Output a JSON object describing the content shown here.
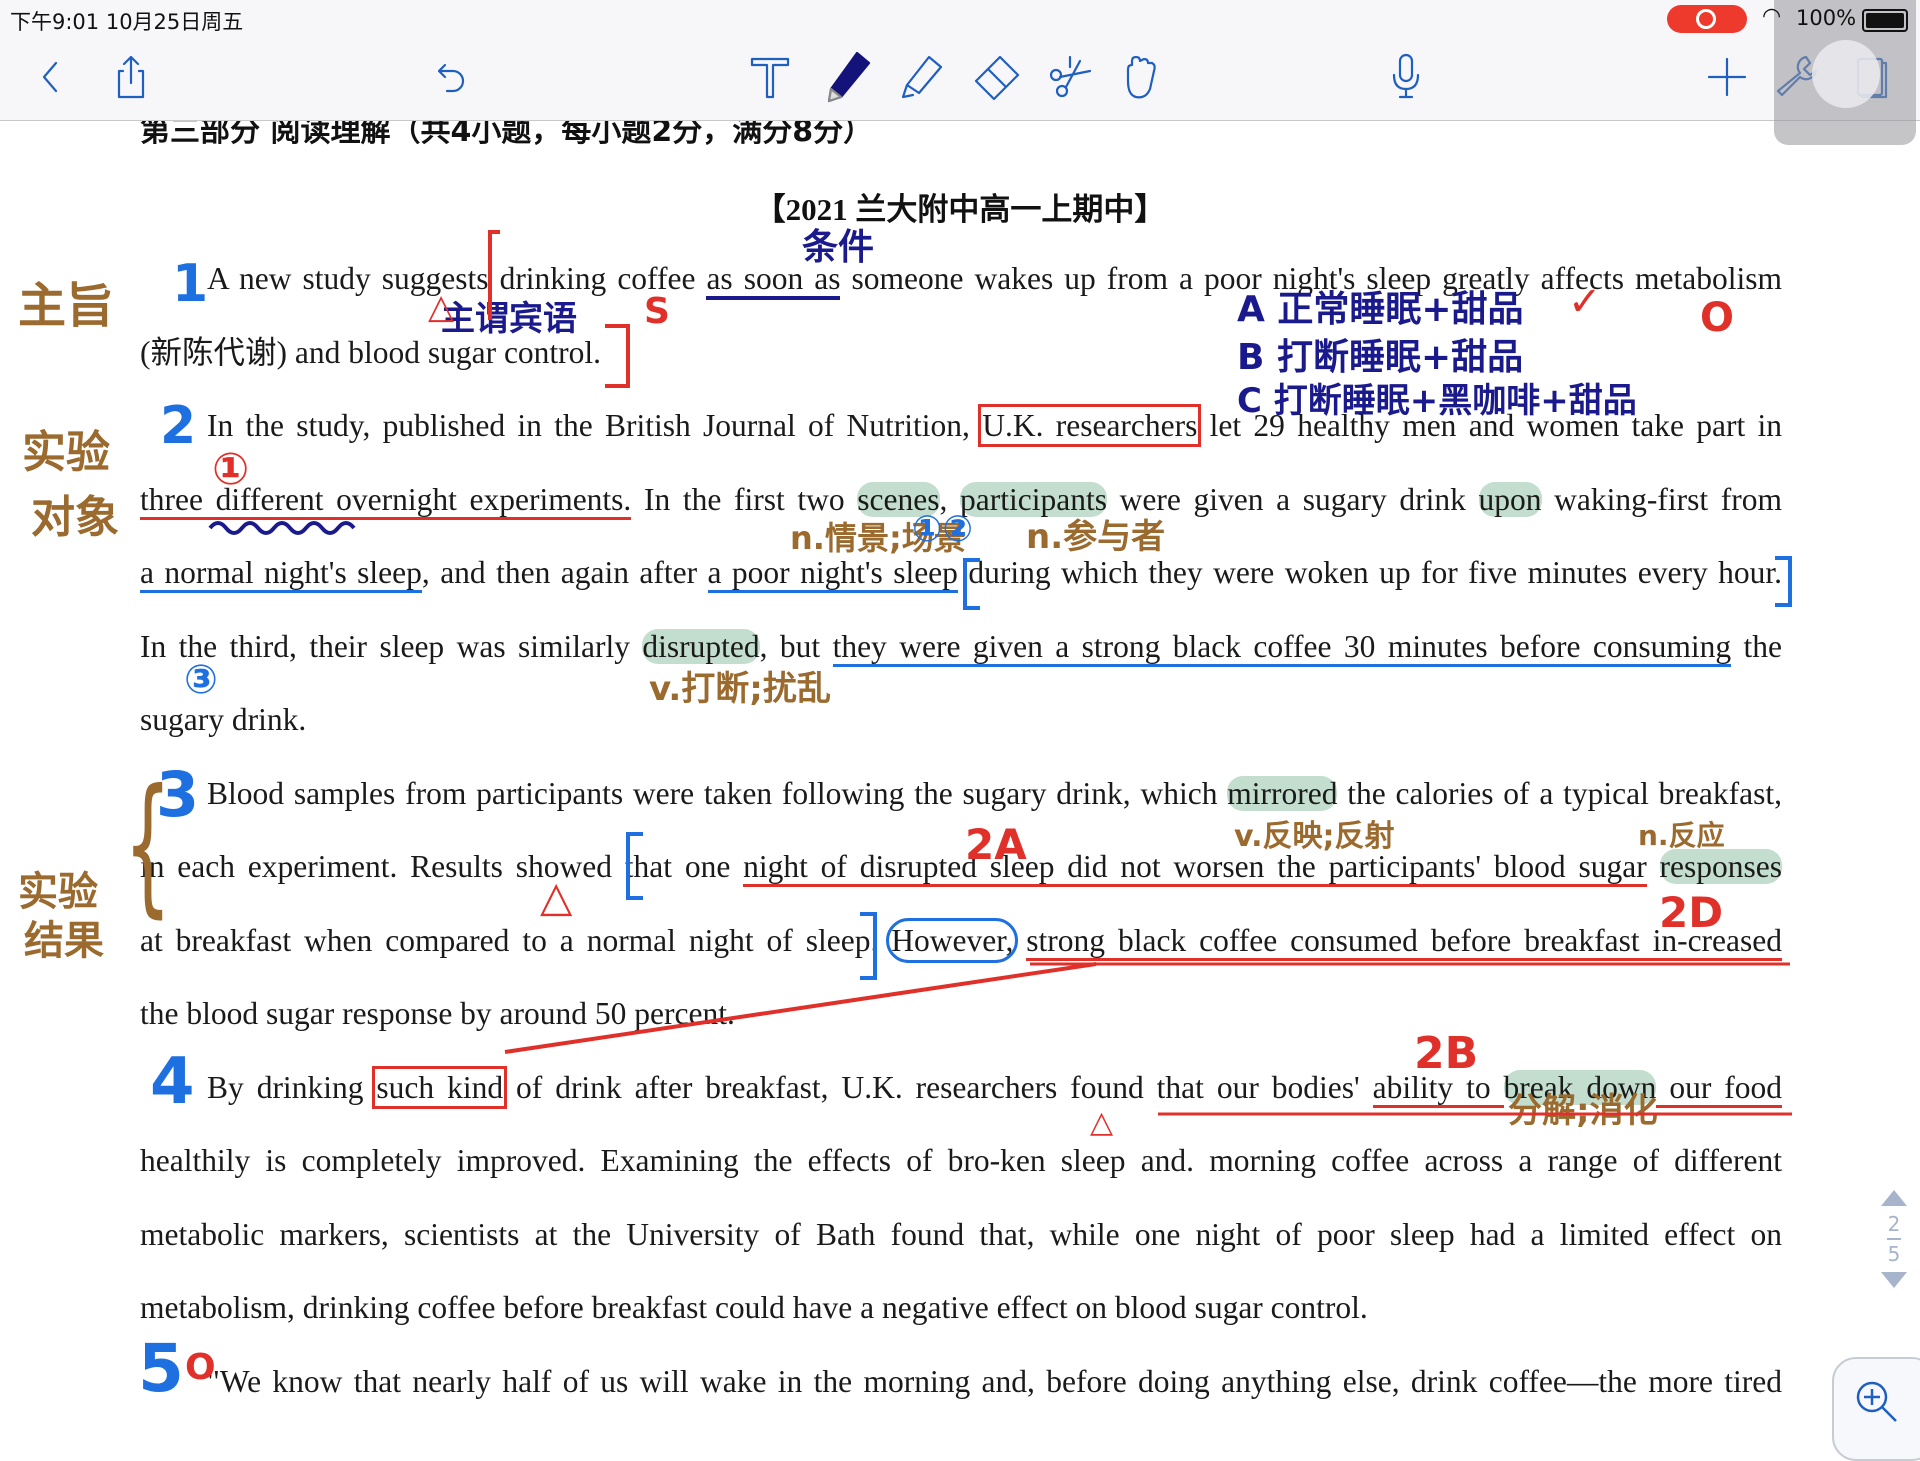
{
  "status": {
    "time": "下午9:01  10月25日周五",
    "battery": "100%",
    "recording": true
  },
  "toolbar": {
    "icons": [
      "back-icon",
      "share-icon",
      "undo-icon",
      "text-tool-icon",
      "pen-tool-icon",
      "highlighter-icon",
      "eraser-icon",
      "lasso-scissors-icon",
      "hand-icon",
      "microphone-icon",
      "add-icon",
      "wrench-icon",
      "pages-icon"
    ],
    "accent": "#1f5fbf",
    "active_tool": "pen-tool-icon"
  },
  "document": {
    "section_title": "第三部分  阅读理解（共4小题，每小题2分，满分8分）",
    "source": "【2021 兰大附中高一上期中】"
  },
  "article": {
    "lines": [
      {
        "segs": [
          {
            "t": "A new study suggests drinking coffee "
          },
          {
            "t": "as soon as",
            "s": "uln"
          },
          {
            "t": " someone wakes up from a poor night's sleep greatly affects metabolism"
          }
        ]
      },
      {
        "segs": [
          {
            "t": "(新陈代谢) and blood sugar control."
          }
        ]
      },
      {
        "segs": [
          {
            "t": "In the study, published in the British Journal of Nutrition, "
          },
          {
            "t": "U.K. researchers",
            "s": "box"
          },
          {
            "t": " let 29 healthy men and women take part in"
          }
        ]
      },
      {
        "segs": [
          {
            "t": "three different overnight experiments.",
            "s": "ulr"
          },
          {
            "t": " In the first two "
          },
          {
            "t": "scenes",
            "s": "hl"
          },
          {
            "t": ", "
          },
          {
            "t": "participants",
            "s": "hl"
          },
          {
            "t": " were given a sugary drink "
          },
          {
            "t": "upon",
            "s": "hl"
          },
          {
            "t": " waking-first from"
          }
        ]
      },
      {
        "segs": [
          {
            "t": "a normal night's sleep",
            "s": "ulb"
          },
          {
            "t": ", and then again after "
          },
          {
            "t": "a poor night's sleep",
            "s": "ulb"
          },
          {
            "t": " during which they were woken up for five minutes every hour."
          }
        ]
      },
      {
        "segs": [
          {
            "t": "In the third, their sleep was similarly "
          },
          {
            "t": "disrupted",
            "s": "hl"
          },
          {
            "t": ", but "
          },
          {
            "t": "they were given a strong black coffee 30 minutes before consuming",
            "s": "ulb"
          },
          {
            "t": " the"
          }
        ]
      },
      {
        "segs": [
          {
            "t": "sugary drink."
          }
        ]
      },
      {
        "segs": [
          {
            "t": "Blood samples from participants were taken following the sugary drink, which "
          },
          {
            "t": "mirrored",
            "s": "hl"
          },
          {
            "t": " the calories of a typical breakfast,"
          }
        ]
      },
      {
        "segs": [
          {
            "t": "in each experiment. Results showed that one "
          },
          {
            "t": "night of disrupted sleep did not worsen the participants' blood sugar",
            "s": "ulr"
          },
          {
            "t": " "
          },
          {
            "t": "responses",
            "s": "hl"
          }
        ]
      },
      {
        "segs": [
          {
            "t": "at breakfast when compared to a normal night of sleep. "
          },
          {
            "t": "However,",
            "s": "circ"
          },
          {
            "t": " "
          },
          {
            "t": "strong black coffee consumed before breakfast in-creased",
            "s": "ulr"
          }
        ]
      },
      {
        "segs": [
          {
            "t": "the blood sugar response by around 50 percent."
          }
        ]
      },
      {
        "segs": [
          {
            "t": "By drinking "
          },
          {
            "t": "such kind",
            "s": "box"
          },
          {
            "t": " of drink after breakfast, U.K. researchers found that our bodies' "
          },
          {
            "t": "ability to ",
            "s": "ulr"
          },
          {
            "t": "break down",
            "s": "hl"
          },
          {
            "t": " our food",
            "s": "ulr"
          }
        ]
      },
      {
        "segs": [
          {
            "t": "healthily is completely improved. Examining the effects of bro-ken sleep and. morning coffee across a range of different"
          }
        ]
      },
      {
        "segs": [
          {
            "t": "metabolic markers, scientists at the University of Bath found that, while one night of poor sleep had a limited effect on"
          }
        ]
      },
      {
        "segs": [
          {
            "t": "metabolism, drinking coffee before breakfast could have a negative effect on blood sugar control."
          }
        ]
      },
      {
        "segs": [
          {
            "t": "\"We know that nearly half of us will wake in the morning and, before doing anything else, drink coffee—the more tired"
          }
        ]
      }
    ]
  },
  "annotations": [
    {
      "t": "主旨",
      "c": "#9a6a2e"
    },
    {
      "t": "实验",
      "c": "#9a6a2e"
    },
    {
      "t": "对象",
      "c": "#9a6a2e"
    },
    {
      "t": "实验",
      "c": "#9a6a2e"
    },
    {
      "t": "结果",
      "c": "#9a6a2e"
    },
    {
      "t": "1",
      "c": "#1e6fe0"
    },
    {
      "t": "2",
      "c": "#1e6fe0"
    },
    {
      "t": "3",
      "c": "#1e6fe0"
    },
    {
      "t": "4",
      "c": "#1e6fe0"
    },
    {
      "t": "5",
      "c": "#1e6fe0"
    },
    {
      "t": "条件",
      "c": "#1a1a8c"
    },
    {
      "t": "主谓宾语",
      "c": "#1a1a8c"
    },
    {
      "t": "A 正常睡眠+甜品",
      "c": "#1a1a8c"
    },
    {
      "t": "B 打断睡眠+甜品",
      "c": "#1a1a8c"
    },
    {
      "t": "C 打断睡眠+黑咖啡+甜品",
      "c": "#1a1a8c"
    },
    {
      "t": "✓",
      "c": "#e0302a"
    },
    {
      "t": "O",
      "c": "#e0302a"
    },
    {
      "t": "①",
      "c": "#e0302a"
    },
    {
      "t": "n.情景;场景",
      "c": "#9a6a2e"
    },
    {
      "t": "①②",
      "c": "#1e6fe0"
    },
    {
      "t": "n.参与者",
      "c": "#9a6a2e"
    },
    {
      "t": "③",
      "c": "#1e6fe0"
    },
    {
      "t": "v.打断;扰乱",
      "c": "#9a6a2e"
    },
    {
      "t": "v.反映;反射",
      "c": "#9a6a2e"
    },
    {
      "t": "n.反应",
      "c": "#9a6a2e"
    },
    {
      "t": "2A",
      "c": "#e0302a"
    },
    {
      "t": "2D",
      "c": "#e0302a"
    },
    {
      "t": "2B",
      "c": "#e0302a"
    },
    {
      "t": "分解;消化",
      "c": "#9a6a2e"
    },
    {
      "t": "△",
      "c": "#e0302a"
    },
    {
      "t": "△",
      "c": "#e0302a"
    },
    {
      "t": "△",
      "c": "#e0302a"
    },
    {
      "t": "S",
      "c": "#e0302a"
    },
    {
      "t": "O",
      "c": "#e0302a"
    },
    {
      "t": "{",
      "c": "#9a6a2e"
    }
  ],
  "pager": {
    "current": "2",
    "total": "5"
  }
}
